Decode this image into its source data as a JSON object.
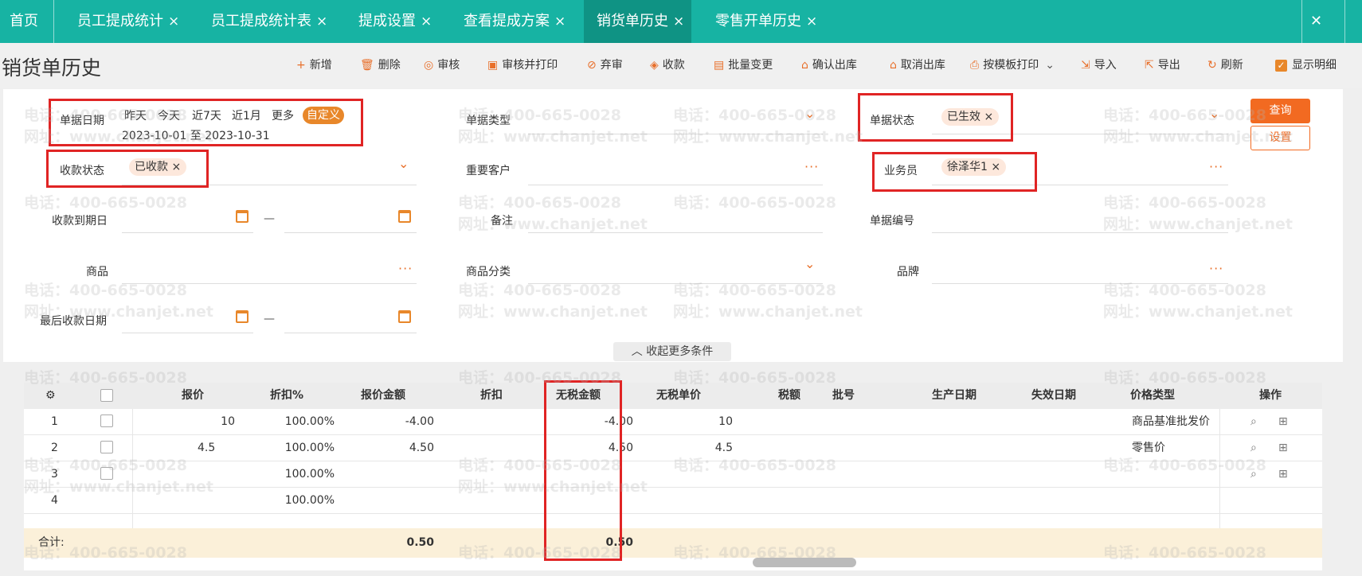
{
  "tabs": [
    {
      "label": "首页",
      "closable": false
    },
    {
      "label": "员工提成统计",
      "closable": true
    },
    {
      "label": "员工提成统计表",
      "closable": true
    },
    {
      "label": "提成设置",
      "closable": true
    },
    {
      "label": "查看提成方案",
      "closable": true
    },
    {
      "label": "销货单历史",
      "closable": true,
      "active": true
    },
    {
      "label": "零售开单历史",
      "closable": true
    }
  ],
  "tab_close_glyph": "×",
  "window_close_glyph": "✕",
  "page_title": "销货单历史",
  "toolbar": [
    {
      "label": "新增",
      "icon": "plus-icon"
    },
    {
      "label": "删除",
      "icon": "trash-icon"
    },
    {
      "label": "审核",
      "icon": "audit-icon"
    },
    {
      "label": "审核并打印",
      "icon": "audit-print-icon"
    },
    {
      "label": "弃审",
      "icon": "unaudit-icon"
    },
    {
      "label": "收款",
      "icon": "receipt-icon"
    },
    {
      "label": "批量变更",
      "icon": "batch-icon"
    },
    {
      "label": "确认出库",
      "icon": "outbound-icon"
    },
    {
      "label": "取消出库",
      "icon": "cancel-outbound-icon"
    },
    {
      "label": "按模板打印",
      "icon": "printer-icon"
    },
    {
      "label": "导入",
      "icon": "import-icon"
    },
    {
      "label": "导出",
      "icon": "export-icon"
    },
    {
      "label": "刷新",
      "icon": "refresh-icon"
    }
  ],
  "show_detail_label": "显示明细",
  "show_detail_checked": true,
  "filters": {
    "doc_date_label": "单据日期",
    "quick_dates": [
      "昨天",
      "今天",
      "近7天",
      "近1月",
      "更多",
      "自定义"
    ],
    "date_range": "2023-10-01 至 2023-10-31",
    "doc_type_label": "单据类型",
    "doc_status_label": "单据状态",
    "doc_status_tag": "已生效",
    "pay_status_label": "收款状态",
    "pay_status_tag": "已收款",
    "key_customer_label": "重要客户",
    "salesperson_label": "业务员",
    "salesperson_tag": "徐泽华1",
    "due_date_label": "收款到期日",
    "remark_label": "备注",
    "doc_no_label": "单据编号",
    "product_label": "商品",
    "category_label": "商品分类",
    "brand_label": "品牌",
    "last_pay_label": "最后收款日期",
    "range_dash": "—",
    "tag_close": "×"
  },
  "query_button": "查询",
  "settings_button": "设置",
  "collapse_label": "收起更多条件",
  "table": {
    "headers": [
      "报价",
      "折扣%",
      "报价金额",
      "折扣",
      "无税金额",
      "无税单价",
      "税额",
      "批号",
      "生产日期",
      "失效日期",
      "价格类型",
      "操作"
    ],
    "rows": [
      {
        "no": "1",
        "quote": "10",
        "discount_pct": "100.00%",
        "quote_amount": "-4.00",
        "notax_amount": "-4.00",
        "notax_price": "10",
        "price_type": "商品基准批发价"
      },
      {
        "no": "2",
        "quote": "4.5",
        "discount_pct": "100.00%",
        "quote_amount": "4.50",
        "notax_amount": "4.50",
        "notax_price": "4.5",
        "price_type": "零售价"
      },
      {
        "no": "3",
        "quote": "",
        "discount_pct": "100.00%",
        "quote_amount": "",
        "notax_amount": "",
        "notax_price": "",
        "price_type": ""
      },
      {
        "no": "4",
        "quote": "",
        "discount_pct": "100.00%",
        "quote_amount": "",
        "notax_amount": "",
        "notax_price": "",
        "price_type": ""
      }
    ],
    "total_label": "合计:",
    "total_quote_amount": "0.50",
    "total_notax_amount": "0.50"
  },
  "watermark_phone": "电话：400-665-0028",
  "watermark_site": "网址：www.chanjet.net",
  "colors": {
    "tab_bar": "#17b3a3",
    "accent": "#f26a21",
    "highlight_box": "#e02424",
    "total_row": "#fbf0d9"
  }
}
